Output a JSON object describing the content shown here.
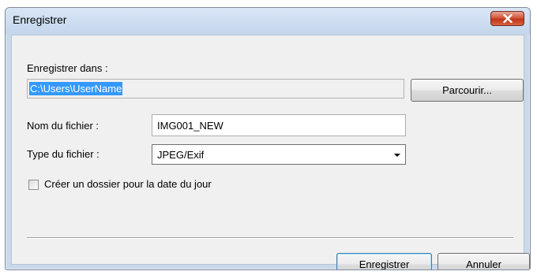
{
  "window": {
    "title": "Enregistrer",
    "close_icon": "close-icon"
  },
  "save_in": {
    "label": "Enregistrer dans :",
    "path": "C:\\Users\\UserName",
    "browse_label": "Parcourir..."
  },
  "file_name": {
    "label": "Nom du fichier :",
    "value": "IMG001_NEW"
  },
  "file_type": {
    "label": "Type du fichier :",
    "selected": "JPEG/Exif"
  },
  "date_folder": {
    "label": "Créer un dossier pour la date du jour",
    "checked": false
  },
  "footer": {
    "save_label": "Enregistrer",
    "cancel_label": "Annuler"
  },
  "colors": {
    "selection": "#3399ff",
    "close_button": "#c0351c"
  }
}
